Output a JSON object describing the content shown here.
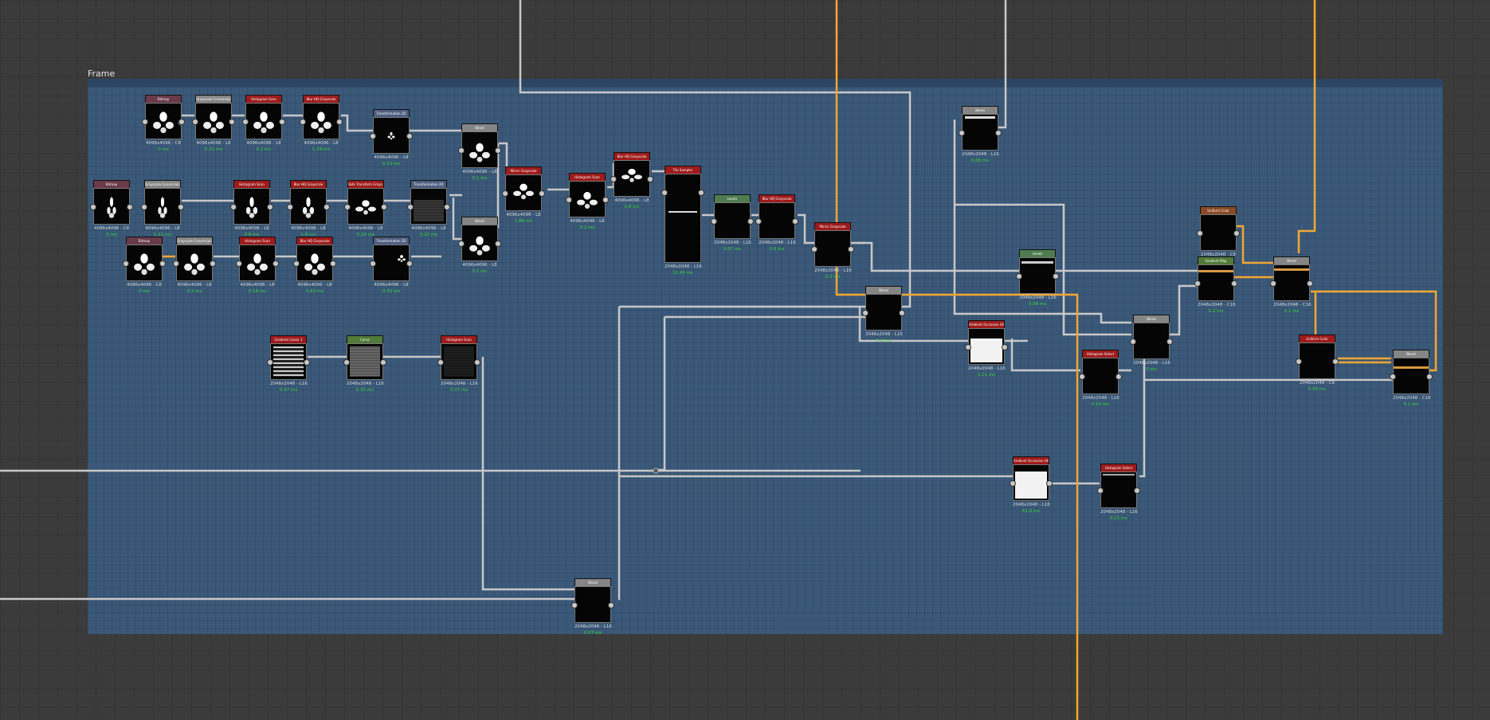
{
  "frame": {
    "title": "Frame"
  },
  "nodes": [
    {
      "label": "Bitmap",
      "res": "4096x4096 - C8",
      "time": "0 ms"
    },
    {
      "label": "Grayscale Conversion",
      "res": "4096x4096 - L8",
      "time": "0.21 ms"
    },
    {
      "label": "Histogram Scan",
      "res": "4096x4096 - L8",
      "time": "0.2 ms"
    },
    {
      "label": "Blur HQ Grayscale",
      "res": "4096x4096 - L8",
      "time": "1.78 ms"
    },
    {
      "label": "Transformation 2D",
      "res": "4096x4096 - L8",
      "time": "0.23 ms"
    },
    {
      "label": "Blend",
      "res": "4096x4096 - L8",
      "time": "0.1 ms"
    },
    {
      "label": "Bitmap",
      "res": "4096x4096 - C8",
      "time": "0 ms"
    },
    {
      "label": "Grayscale Conversion",
      "res": "4096x4096 - L8",
      "time": "1.11 ms"
    },
    {
      "label": "Histogram Scan",
      "res": "4096x4096 - L8",
      "time": "0.6 ms"
    },
    {
      "label": "Blur HQ Grayscale",
      "res": "4096x4096 - L8",
      "time": "1.8 ms"
    },
    {
      "label": "Safe Transform Grays...",
      "res": "4096x4096 - L8",
      "time": "0.24 ms"
    },
    {
      "label": "Transformation 2D",
      "res": "4096x4096 - L8",
      "time": "0.22 ms"
    },
    {
      "label": "Bitmap",
      "res": "4096x4096 - C8",
      "time": "0 ms"
    },
    {
      "label": "Grayscale Conversion",
      "res": "4096x4096 - L8",
      "time": "0.2 ms"
    },
    {
      "label": "Histogram Scan",
      "res": "4096x4096 - L8",
      "time": "0.18 ms"
    },
    {
      "label": "Blur HQ Grayscale",
      "res": "4096x4096 - L8",
      "time": "1.61 ms"
    },
    {
      "label": "Transformation 2D",
      "res": "4096x4096 - L8",
      "time": "0.23 ms"
    },
    {
      "label": "Blend",
      "res": "4096x4096 - L8",
      "time": "0.2 ms"
    },
    {
      "label": "Mirror Grayscale",
      "res": "4096x4096 - L8",
      "time": "1.86 ms"
    },
    {
      "label": "Histogram Scan",
      "res": "4096x4096 - L8",
      "time": "0.2 ms"
    },
    {
      "label": "Blur HQ Grayscale",
      "res": "4096x4096 - L8",
      "time": "0.8 ms"
    },
    {
      "label": "Tile Sampler",
      "res": "2048x2048 - L16",
      "time": "11.49 ms"
    },
    {
      "label": "Levels",
      "res": "2048x2048 - L16",
      "time": "0.07 ms"
    },
    {
      "label": "Blur HQ Grayscale",
      "res": "2048x2048 - L16",
      "time": "0.6 ms"
    },
    {
      "label": "Mirror Grayscale",
      "res": "2048x2048 - L16",
      "time": "0.2 ms"
    },
    {
      "label": "Blend",
      "res": "2048x2048 - L16",
      "time": "0.2 ms"
    },
    {
      "label": "Blend",
      "res": "2048x2048 - L16",
      "time": "0.08 ms"
    },
    {
      "label": "Levels",
      "res": "2048x2048 - L16",
      "time": "0.08 ms"
    },
    {
      "label": "Gradient Linear 1",
      "res": "2048x2048 - L16",
      "time": "0.47 ms"
    },
    {
      "label": "Curve",
      "res": "2048x2048 - L16",
      "time": "0.35 ms"
    },
    {
      "label": "Histogram Scan",
      "res": "2048x2048 - L16",
      "time": "0.07 ms"
    },
    {
      "label": "Ambient Occlusion (HB...",
      "res": "2048x2048 - L16",
      "time": "3.11 ms"
    },
    {
      "label": "Histogram Select",
      "res": "2048x2048 - L16",
      "time": "0.14 ms"
    },
    {
      "label": "Blend",
      "res": "2048x2048 - L16",
      "time": "0 ms"
    },
    {
      "label": "Uniform Color",
      "res": "2048x2048 - C8",
      "time": ""
    },
    {
      "label": "Gradient Map",
      "res": "2048x2048 - C16",
      "time": "0.2 ms"
    },
    {
      "label": "Blend",
      "res": "2048x2048 - C16",
      "time": "0.1 ms"
    },
    {
      "label": "Uniform Color",
      "res": "2048x2048 - C8",
      "time": "0.00 ms"
    },
    {
      "label": "Blend",
      "res": "2048x2048 - C16",
      "time": "0.1 ms"
    },
    {
      "label": "Ambient Occlusion (HB...",
      "res": "2048x2048 - L16",
      "time": "61.8 ms"
    },
    {
      "label": "Histogram Select",
      "res": "2048x2048 - L16",
      "time": "0.11 ms"
    },
    {
      "label": "Blend",
      "res": "2048x2048 - L16",
      "time": "0.07 ms"
    }
  ],
  "colors": {
    "canvas": "#3b3b3b",
    "frame": "#3a5878",
    "wire": "#c8c8c8",
    "wire_color": "#f4a733",
    "time": "#38d838"
  }
}
